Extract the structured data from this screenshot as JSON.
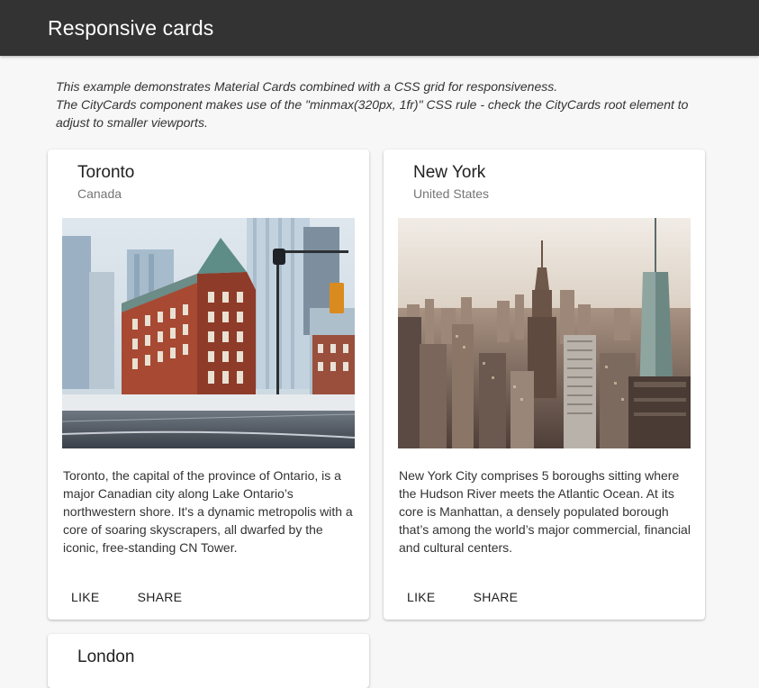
{
  "appbar": {
    "title": "Responsive cards"
  },
  "intro": {
    "line1": "This example demonstrates Material Cards combined with a CSS grid for responsiveness.",
    "line2": "The CityCards component makes use of the \"minmax(320px, 1fr)\" CSS rule - check the CityCards root element to adjust to smaller viewports."
  },
  "cards": [
    {
      "title": "Toronto",
      "subtitle": "Canada",
      "text": "Toronto, the capital of the province of Ontario, is a major Canadian city along Lake Ontario’s northwestern shore. It's a dynamic metropolis with a core of soaring skyscrapers, all dwarfed by the iconic, free-standing CN Tower.",
      "like_label": "LIKE",
      "share_label": "SHARE"
    },
    {
      "title": "New York",
      "subtitle": "United States",
      "text": "New York City comprises 5 boroughs sitting where the Hudson River meets the Atlantic Ocean. At its core is Manhattan, a densely populated borough that’s among the world’s major commercial, financial and cultural centers.",
      "like_label": "LIKE",
      "share_label": "SHARE"
    },
    {
      "title": "London"
    }
  ],
  "colors": {
    "appbar": "#333333",
    "background": "#f7f7f7",
    "card": "#ffffff"
  }
}
